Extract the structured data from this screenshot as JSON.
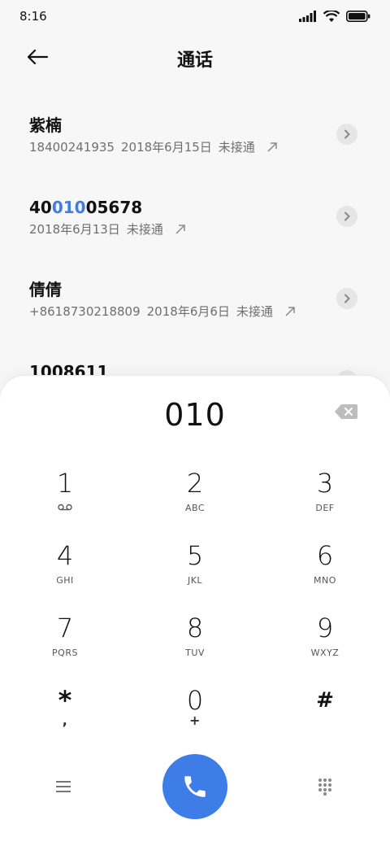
{
  "status": {
    "time": "8:16"
  },
  "header": {
    "title": "通话"
  },
  "calls": [
    {
      "name": "紫楠",
      "number": "18400241935",
      "date": "2018年6月15日",
      "status": "未接通"
    },
    {
      "name_pre": "40",
      "name_hl": "010",
      "name_post": "05678",
      "date": "2018年6月13日",
      "status": "未接通"
    },
    {
      "name": "倩倩",
      "number": "+8618730218809",
      "date": "2018年6月6日",
      "status": "未接通"
    },
    {
      "name": "1008611"
    }
  ],
  "dialer": {
    "input": "010",
    "keys": [
      {
        "digit": "1",
        "sub": ""
      },
      {
        "digit": "2",
        "sub": "ABC"
      },
      {
        "digit": "3",
        "sub": "DEF"
      },
      {
        "digit": "4",
        "sub": "GHI"
      },
      {
        "digit": "5",
        "sub": "JKL"
      },
      {
        "digit": "6",
        "sub": "MNO"
      },
      {
        "digit": "7",
        "sub": "PQRS"
      },
      {
        "digit": "8",
        "sub": "TUV"
      },
      {
        "digit": "9",
        "sub": "WXYZ"
      },
      {
        "digit": "*",
        "sub": ","
      },
      {
        "digit": "0",
        "sub": "+"
      },
      {
        "digit": "#",
        "sub": ""
      }
    ]
  },
  "colors": {
    "accent": "#3e7de8",
    "background": "#f7f7f7",
    "text": "#111111",
    "muted": "#6f6f6f"
  }
}
